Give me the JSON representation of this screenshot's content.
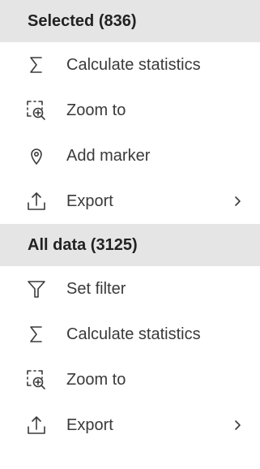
{
  "sections": [
    {
      "header": "Selected (836)",
      "items": [
        {
          "label": "Calculate statistics",
          "icon": "sigma-icon"
        },
        {
          "label": "Zoom to",
          "icon": "zoom-to-icon"
        },
        {
          "label": "Add marker",
          "icon": "map-pin-icon"
        },
        {
          "label": "Export",
          "icon": "export-icon",
          "submenu": true
        }
      ]
    },
    {
      "header": "All data (3125)",
      "items": [
        {
          "label": "Set filter",
          "icon": "filter-icon"
        },
        {
          "label": "Calculate statistics",
          "icon": "sigma-icon"
        },
        {
          "label": "Zoom to",
          "icon": "zoom-to-icon"
        },
        {
          "label": "Export",
          "icon": "export-icon",
          "submenu": true
        }
      ]
    }
  ],
  "colors": {
    "header_background": "#e5e5e5",
    "text": "#3a3a3a",
    "header_text": "#222222"
  }
}
